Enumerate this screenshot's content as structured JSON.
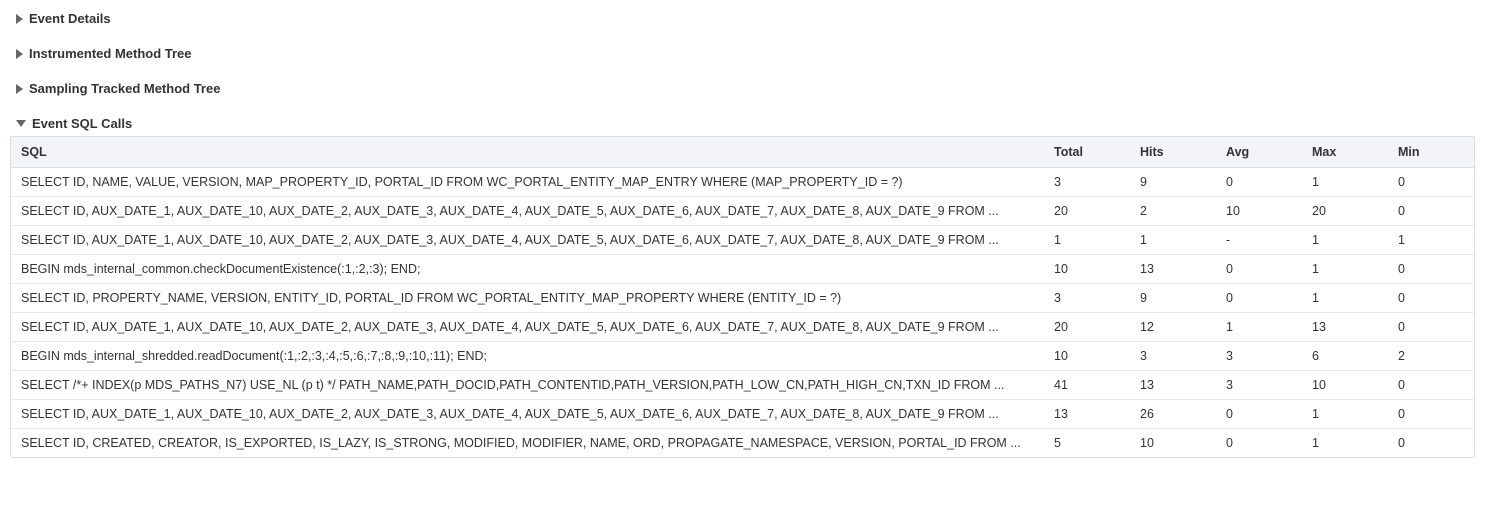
{
  "sections": {
    "event_details": {
      "title": "Event Details",
      "expanded": false
    },
    "instrumented_tree": {
      "title": "Instrumented Method Tree",
      "expanded": false
    },
    "sampling_tree": {
      "title": "Sampling Tracked Method Tree",
      "expanded": false
    },
    "sql_calls": {
      "title": "Event SQL Calls",
      "expanded": true
    }
  },
  "sql_table": {
    "columns": {
      "sql": "SQL",
      "total": "Total",
      "hits": "Hits",
      "avg": "Avg",
      "max": "Max",
      "min": "Min"
    },
    "rows": [
      {
        "sql": "SELECT ID, NAME, VALUE, VERSION, MAP_PROPERTY_ID, PORTAL_ID FROM WC_PORTAL_ENTITY_MAP_ENTRY WHERE (MAP_PROPERTY_ID = ?)",
        "total": "3",
        "hits": "9",
        "avg": "0",
        "max": "1",
        "min": "0"
      },
      {
        "sql": "SELECT ID, AUX_DATE_1, AUX_DATE_10, AUX_DATE_2, AUX_DATE_3, AUX_DATE_4, AUX_DATE_5, AUX_DATE_6, AUX_DATE_7, AUX_DATE_8, AUX_DATE_9 FROM ...",
        "total": "20",
        "hits": "2",
        "avg": "10",
        "max": "20",
        "min": "0"
      },
      {
        "sql": "SELECT ID, AUX_DATE_1, AUX_DATE_10, AUX_DATE_2, AUX_DATE_3, AUX_DATE_4, AUX_DATE_5, AUX_DATE_6, AUX_DATE_7, AUX_DATE_8, AUX_DATE_9 FROM ...",
        "total": "1",
        "hits": "1",
        "avg": "-",
        "max": "1",
        "min": "1"
      },
      {
        "sql": "BEGIN mds_internal_common.checkDocumentExistence(:1,:2,:3); END;",
        "total": "10",
        "hits": "13",
        "avg": "0",
        "max": "1",
        "min": "0"
      },
      {
        "sql": "SELECT ID, PROPERTY_NAME, VERSION, ENTITY_ID, PORTAL_ID FROM WC_PORTAL_ENTITY_MAP_PROPERTY WHERE (ENTITY_ID = ?)",
        "total": "3",
        "hits": "9",
        "avg": "0",
        "max": "1",
        "min": "0"
      },
      {
        "sql": "SELECT ID, AUX_DATE_1, AUX_DATE_10, AUX_DATE_2, AUX_DATE_3, AUX_DATE_4, AUX_DATE_5, AUX_DATE_6, AUX_DATE_7, AUX_DATE_8, AUX_DATE_9 FROM ...",
        "total": "20",
        "hits": "12",
        "avg": "1",
        "max": "13",
        "min": "0"
      },
      {
        "sql": "BEGIN mds_internal_shredded.readDocument(:1,:2,:3,:4,:5,:6,:7,:8,:9,:10,:11); END;",
        "total": "10",
        "hits": "3",
        "avg": "3",
        "max": "6",
        "min": "2"
      },
      {
        "sql": "SELECT /*+ INDEX(p MDS_PATHS_N7) USE_NL (p t) */ PATH_NAME,PATH_DOCID,PATH_CONTENTID,PATH_VERSION,PATH_LOW_CN,PATH_HIGH_CN,TXN_ID FROM ...",
        "total": "41",
        "hits": "13",
        "avg": "3",
        "max": "10",
        "min": "0"
      },
      {
        "sql": "SELECT ID, AUX_DATE_1, AUX_DATE_10, AUX_DATE_2, AUX_DATE_3, AUX_DATE_4, AUX_DATE_5, AUX_DATE_6, AUX_DATE_7, AUX_DATE_8, AUX_DATE_9 FROM ...",
        "total": "13",
        "hits": "26",
        "avg": "0",
        "max": "1",
        "min": "0"
      },
      {
        "sql": "SELECT ID, CREATED, CREATOR, IS_EXPORTED, IS_LAZY, IS_STRONG, MODIFIED, MODIFIER, NAME, ORD, PROPAGATE_NAMESPACE, VERSION, PORTAL_ID FROM ...",
        "total": "5",
        "hits": "10",
        "avg": "0",
        "max": "1",
        "min": "0"
      }
    ]
  }
}
